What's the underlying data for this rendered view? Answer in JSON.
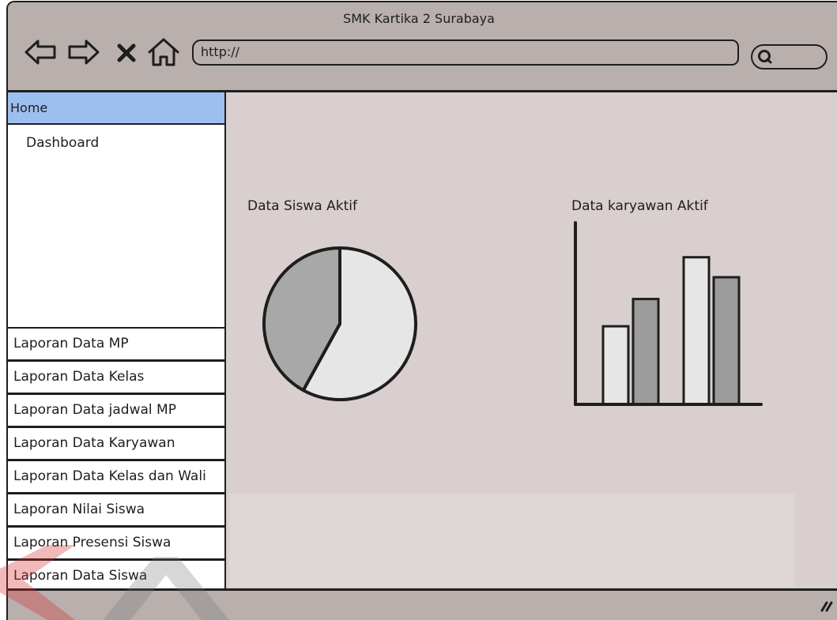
{
  "window": {
    "title": "SMK Kartika 2 Surabaya",
    "colors": {
      "chrome": "#b9b0ae",
      "content": "#d8cfce",
      "panel": "#ffffff",
      "highlight": "#9dbff0",
      "ink": "#1e1e1e"
    }
  },
  "toolbar": {
    "icons": {
      "back": "back-arrow-icon",
      "forward": "forward-arrow-icon",
      "stop": "close-icon",
      "home": "home-icon",
      "search": "search-icon"
    },
    "url": "http://"
  },
  "sidebar": {
    "home": {
      "label": "Home",
      "selected": true
    },
    "dashboard": {
      "label": "Dashboard"
    },
    "items": [
      {
        "label": "Laporan Data MP"
      },
      {
        "label": "Laporan Data Kelas"
      },
      {
        "label": "Laporan Data jadwal MP"
      },
      {
        "label": "Laporan Data Karyawan"
      },
      {
        "label": "Laporan Data Kelas dan Wali"
      },
      {
        "label": "Laporan Nilai Siswa"
      },
      {
        "label": "Laporan Presensi Siswa"
      },
      {
        "label": "Laporan Data Siswa"
      }
    ]
  },
  "statusbar": {
    "resize_icon": "resize-grip-icon"
  },
  "chart_data": [
    {
      "type": "pie",
      "title": "Data Siswa Aktif",
      "slices": [
        {
          "value": 58,
          "color": "#e6e6e6"
        },
        {
          "value": 42,
          "color": "#a8a8a8"
        }
      ]
    },
    {
      "type": "bar",
      "title": "Data karyawan Aktif",
      "xlabel": "",
      "ylabel": "",
      "ylim": [
        0,
        100
      ],
      "grid": false,
      "series": [
        {
          "color": "#e6e6e6",
          "values": [
            43,
            81
          ]
        },
        {
          "color": "#9c9c9c",
          "values": [
            58,
            70
          ]
        }
      ]
    }
  ]
}
